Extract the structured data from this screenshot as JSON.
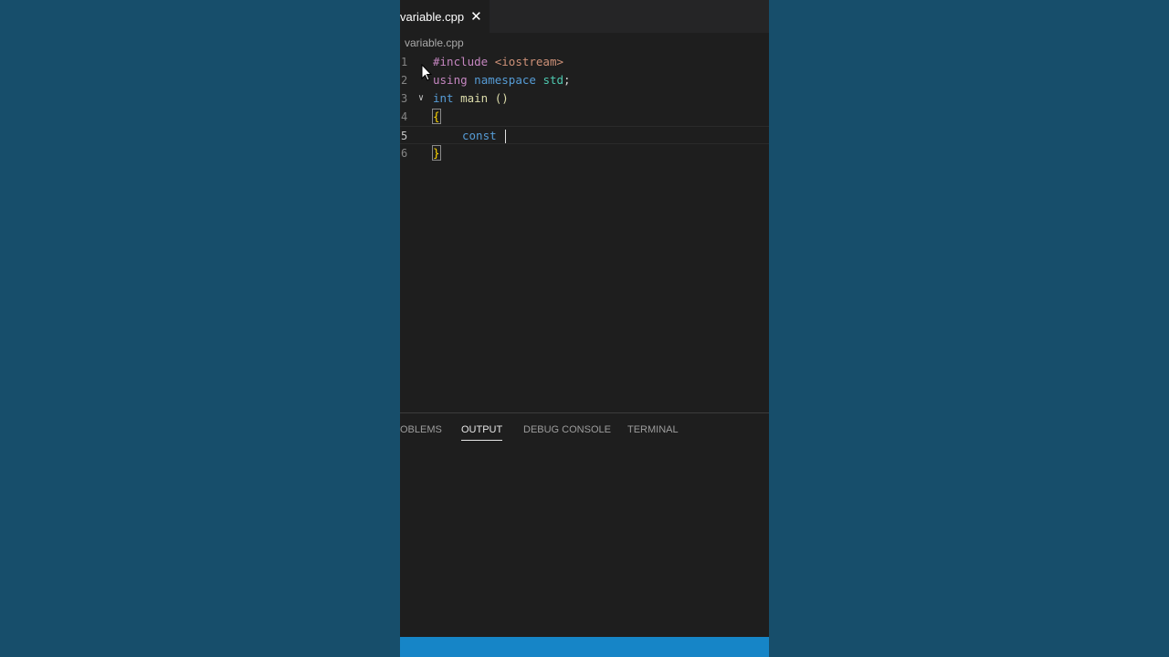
{
  "tab": {
    "label": "variable.cpp",
    "close_glyph": "✕"
  },
  "breadcrumb": "variable.cpp",
  "code_lines": [
    {
      "num": "1"
    },
    {
      "num": "2"
    },
    {
      "num": "3"
    },
    {
      "num": "4"
    },
    {
      "num": "5"
    },
    {
      "num": "6"
    }
  ],
  "tokens": {
    "include": "#include",
    "header": "<iostream>",
    "using": "using",
    "namespace": "namespace",
    "std": "std",
    "semicolon": ";",
    "int": "int",
    "main": "main",
    "parens": "()",
    "open_brace": "{",
    "const": "const",
    "close_brace": "}"
  },
  "panel": {
    "tabs": [
      "OBLEMS",
      "OUTPUT",
      "DEBUG CONSOLE",
      "TERMINAL"
    ],
    "active_tab": "OUTPUT"
  },
  "colors": {
    "background": "#174e6b",
    "editor": "#1e1e1e",
    "statusbar": "#1685c7"
  }
}
